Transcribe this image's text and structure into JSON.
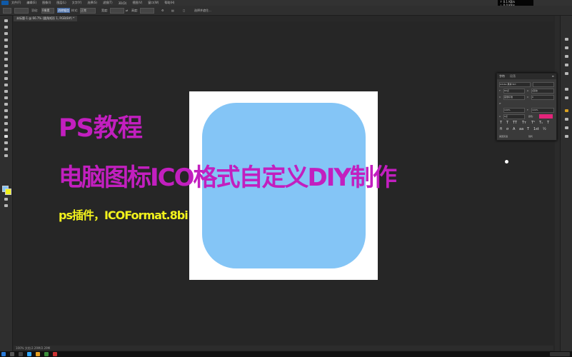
{
  "app": {
    "menu": [
      "文件(F)",
      "编辑(E)",
      "图像(I)",
      "图层(L)",
      "文字(Y)",
      "选择(S)",
      "滤镜(T)",
      "3D(D)",
      "视图(V)",
      "窗口(W)",
      "帮助(H)"
    ],
    "options": {
      "feather_label": "羽化:",
      "feather_value": "0像素",
      "antialias_label": "消除锯齿",
      "style_label": "样式:",
      "style_value": "正常",
      "width_label": "宽度:",
      "height_label": "高度:",
      "refine_label": "选择并遮住..."
    },
    "document_tab": "未标题-1 @ 66.7% (圆角矩形 1, RGB/8#) *",
    "status": "100%    文档:2.29M/2.29M",
    "top_right": {
      "line1": "↑ 0.1 KB/s",
      "line2": "↓ 0.0 KB/s"
    }
  },
  "character_panel": {
    "tab_character": "字符",
    "tab_paragraph": "段落",
    "font_family": "Adobe 黑体 Std",
    "font_size": "60点",
    "leading": "(自动)",
    "kerning": "度量标准",
    "tracking": "0",
    "vertical_scale": "100%",
    "horizontal_scale": "100%",
    "baseline": "0点",
    "color_label": "颜色:",
    "language": "美国英语",
    "antialias": "锐利"
  },
  "overlay": {
    "title": "PS教程",
    "subtitle": "电脑图标ICO格式自定义DIY制作",
    "note": "ps插件，ICOFormat.8bi"
  },
  "colors": {
    "title_color": "#c21fbf",
    "note_color": "#f2f21c",
    "icon_fill": "#84c5f6",
    "panel_swatch": "#e3247a"
  }
}
